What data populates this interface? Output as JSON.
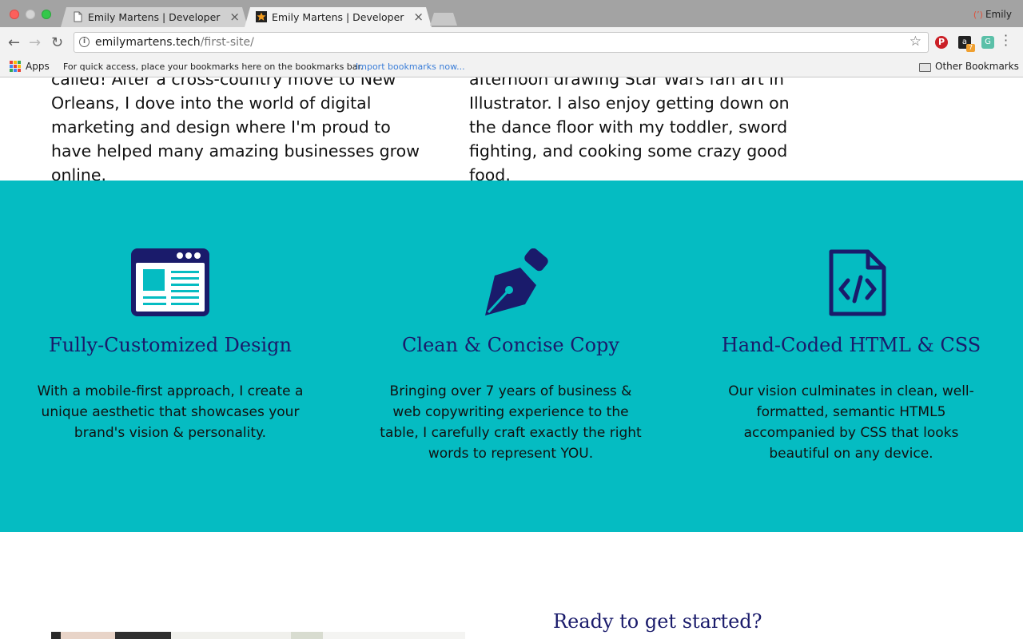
{
  "browser": {
    "tabs": [
      {
        "title": "Emily Martens | Developer",
        "active": false
      },
      {
        "title": "Emily Martens | Developer",
        "active": true
      }
    ],
    "profile_name": "Emily",
    "url_host": "emilymartens.tech",
    "url_path": "/first-site/",
    "bookmarks_bar": {
      "apps_label": "Apps",
      "message": "For quick access, place your bookmarks here on the bookmarks bar.",
      "import_link": "Import bookmarks now...",
      "other_bookmarks": "Other Bookmarks"
    }
  },
  "about": {
    "left_text": "called! After a cross-country move to New Orleans, I dove into the world of digital marketing and design where I'm proud to have helped many amazing businesses grow online.",
    "right_text": "afternoon drawing Star Wars fan art in Illustrator. I also enjoy getting down on the dance floor with my toddler, sword fighting, and cooking some crazy good food."
  },
  "features": {
    "background_color": "#05bcc2",
    "heading_color": "#1a1b6b",
    "items": [
      {
        "icon": "browser-layout-icon",
        "title": "Fully-Customized Design",
        "text": "With a mobile-first approach, I create a unique aesthetic that showcases your brand's vision & personality."
      },
      {
        "icon": "fountain-pen-icon",
        "title": "Clean & Concise Copy",
        "text": "Bringing over 7 years of business & web copywriting experience to the table, I carefully craft exactly the right words to represent YOU."
      },
      {
        "icon": "code-file-icon",
        "title": "Hand-Coded HTML & CSS",
        "text": "Our vision culminates in clean, well-formatted, semantic HTML5 accompanied by CSS that looks beautiful on any device."
      }
    ]
  },
  "cta": {
    "title": "Ready to get started?"
  }
}
